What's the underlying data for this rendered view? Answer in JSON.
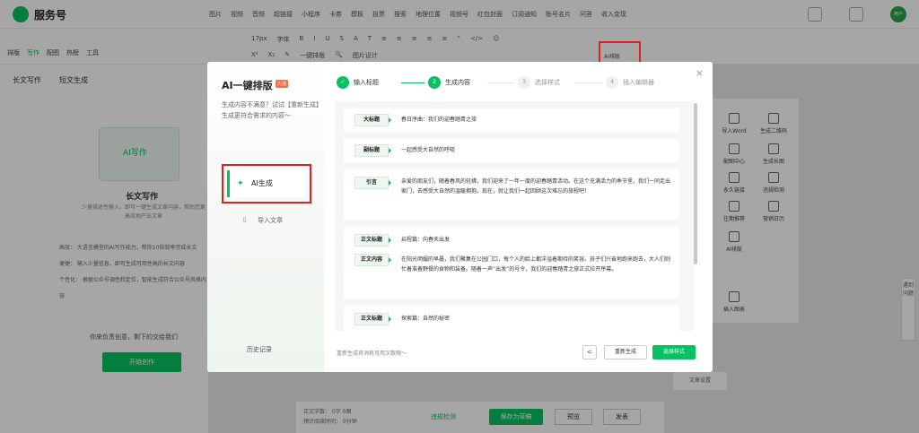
{
  "app": {
    "name": "服务号"
  },
  "top_menu": [
    "图片",
    "视频",
    "音频",
    "超链接",
    "小程序",
    "卡券",
    "模板",
    "投票",
    "搜索",
    "地理位置",
    "视频号",
    "红包封面",
    "订阅通知",
    "账号名片",
    "问答",
    "收入变现"
  ],
  "avatar_label": "用户",
  "side_tabs": {
    "layout": "排版",
    "write": "写作",
    "image": "配图",
    "hot": "热榜",
    "tools": "工具"
  },
  "toolbar_row1": [
    "17px",
    "字体",
    "B",
    "I",
    "U",
    "S",
    "A",
    "T",
    "≡",
    "≡",
    "≡",
    "≡",
    "≡",
    "“",
    "</>",
    "☺"
  ],
  "toolbar_row2": [
    "X²",
    "X₂",
    "✎",
    "一键排版",
    "🔍",
    "图片设计",
    "AI排版"
  ],
  "left_panel": {
    "tab1": "长文写作",
    "tab2": "短文生成",
    "illu_text": "AI写作",
    "title": "长文写作",
    "desc": "少量描述性输入，即可一键生成文章内容，帮助您更高效地产出文章",
    "items": [
      "高效： 大语言模型的AI写作能力，帮你10倍效率完成长文",
      "便捷： 输入少量信息，即可生成可用性高的长文内容",
      "个性化： 根据公众号调性和定位，智能生成符合公众号风格内容"
    ],
    "note": "你来负责创意，剩下的交给我们",
    "button": "开始创作"
  },
  "editor_bottom": {
    "count1": "正文字数： 0字 0图",
    "count2": "预计阅读时间： 0分钟",
    "detect": "违规检测",
    "save": "保存为草稿",
    "preview": "预览",
    "publish": "发表"
  },
  "right_panel": [
    "导入Word",
    "生成二维码",
    "配图中心",
    "生成长图",
    "永久链接",
    "违规检测",
    "往期推荐",
    "营销日历",
    "AI排版",
    "插入图表"
  ],
  "right_settings": "文章设置",
  "help": "遇到问题",
  "ai_highlight": "AI排版",
  "modal": {
    "title": "AI一键排版",
    "badge": "内测",
    "desc": "生成内容不满意？试试【重新生成】生成更符合需求的内容～",
    "generate": "AI生成",
    "import": "导入文章",
    "history": "历史记录",
    "close": "×",
    "steps": [
      "输入标题",
      "生成内容",
      "选择样式",
      "插入编辑器"
    ],
    "cards": [
      {
        "tag": "大标题",
        "text": "春日序曲：我们的迎春踏青之旅"
      },
      {
        "tag": "副标题",
        "text": "一起感受大自然的呼吸"
      },
      {
        "tag": "引言",
        "text": "亲爱的朋友们，随着春风的轻拂，我们迎来了一年一度的迎春踏青活动。在这个充满活力的季节里，我们一同走出家门，去感受大自然的温暖拥抱。现在，就让我们一起回顾这次难忘的旅程吧！"
      },
      {
        "tag": "正文标题",
        "text": "启程篇：向春天出发"
      },
      {
        "tag": "正文内容",
        "text": "在阳光明媚的早晨，我们聚集在公园门口，每个人的脸上都洋溢着期待的笑容。孩子们兴奋地跑来跑去，大人们则忙着准备野餐的食物和装备。随着一声“出发”的号令，我们的迎春踏青之旅正式拉开序幕。"
      },
      {
        "tag": "正文标题",
        "text": "探索篇：自然的秘密"
      }
    ],
    "footer_note": "重新生成将消耗可用次数哦～",
    "back": "<",
    "regenerate": "重新生成",
    "next": "选择样式"
  }
}
